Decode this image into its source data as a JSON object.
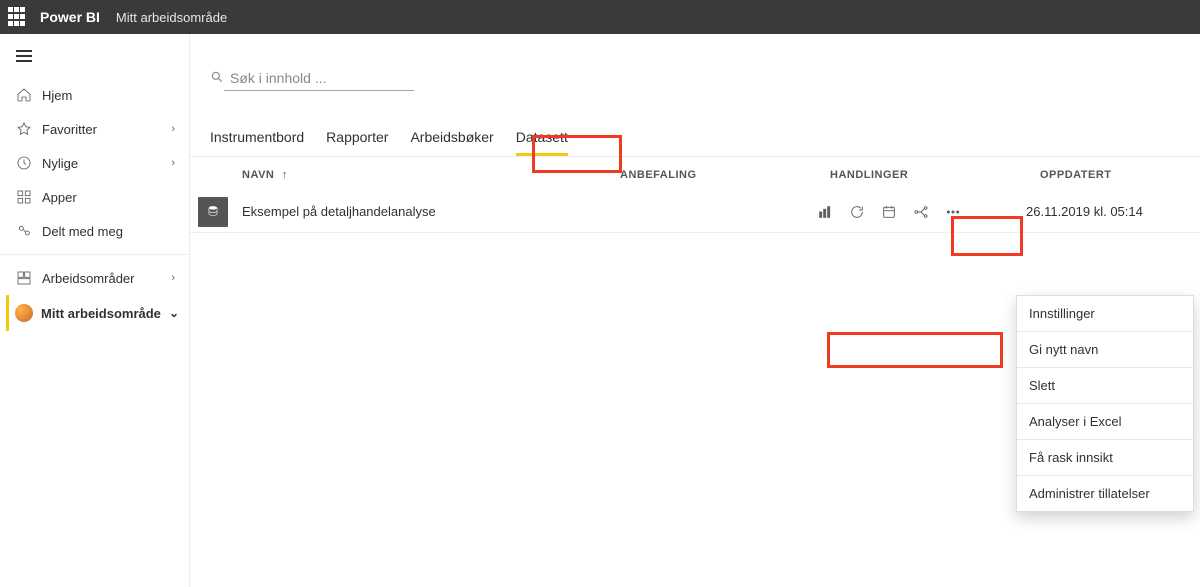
{
  "header": {
    "brand": "Power BI",
    "workspace_title": "Mitt arbeidsområde"
  },
  "sidebar": {
    "items": [
      {
        "icon": "home",
        "label": "Hjem",
        "chevron": false
      },
      {
        "icon": "star",
        "label": "Favoritter",
        "chevron": true
      },
      {
        "icon": "clock",
        "label": "Nylige",
        "chevron": true
      },
      {
        "icon": "apps",
        "label": "Apper",
        "chevron": false
      },
      {
        "icon": "share",
        "label": "Delt med meg",
        "chevron": false
      }
    ],
    "workspaces_label": "Arbeidsområder",
    "current_workspace": "Mitt arbeidsområde"
  },
  "search": {
    "placeholder": "Søk i innhold ..."
  },
  "tabs": [
    {
      "label": "Instrumentbord",
      "active": false
    },
    {
      "label": "Rapporter",
      "active": false
    },
    {
      "label": "Arbeidsbøker",
      "active": false
    },
    {
      "label": "Datasett",
      "active": true
    }
  ],
  "columns": {
    "name": "NAVN",
    "reco": "ANBEFALING",
    "actions": "HANDLINGER",
    "updated": "OPPDATERT"
  },
  "row": {
    "name": "Eksempel på detaljhandelanalyse",
    "updated": "26.11.2019 kl. 05:14"
  },
  "context_menu": [
    "Innstillinger",
    "Gi nytt navn",
    "Slett",
    "Analyser i Excel",
    "Få rask innsikt",
    "Administrer tillatelser"
  ]
}
